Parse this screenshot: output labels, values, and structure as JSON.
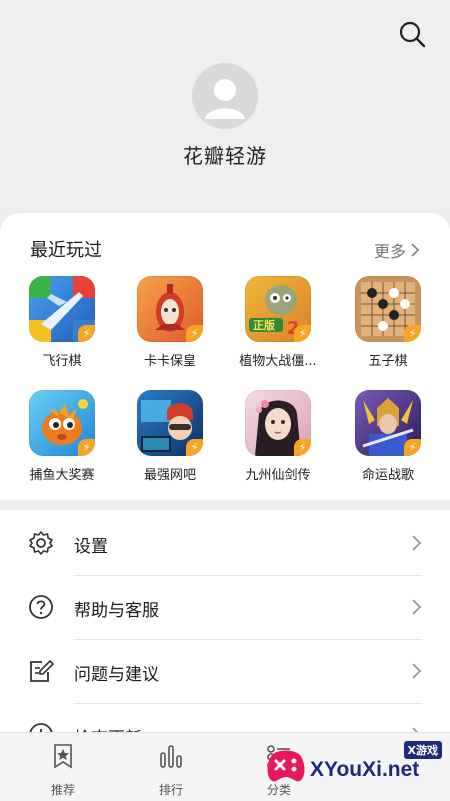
{
  "header": {
    "username": "花瓣轻游",
    "search_icon": "search-icon",
    "avatar_icon": "avatar-icon"
  },
  "recent": {
    "title": "最近玩过",
    "more_label": "更多",
    "games": [
      {
        "name": "飞行棋",
        "icon": "ludo-plane-icon",
        "color": "#3a7bd5"
      },
      {
        "name": "卡卡保皇",
        "icon": "robot-card-icon",
        "color": "#e8643a"
      },
      {
        "name": "植物大战僵...",
        "icon": "zombie-game-icon",
        "color": "#e59b2a"
      },
      {
        "name": "五子棋",
        "icon": "gomoku-board-icon",
        "color": "#c8955a"
      },
      {
        "name": "捕鱼大奖赛",
        "icon": "fish-game-icon",
        "color": "#2ea3e6"
      },
      {
        "name": "最强网吧",
        "icon": "internet-cafe-icon",
        "color": "#1e4e8c"
      },
      {
        "name": "九州仙剑传",
        "icon": "fantasy-girl-icon",
        "color": "#e9b8c4"
      },
      {
        "name": "命运战歌",
        "icon": "warrior-game-icon",
        "color": "#4a3a8a"
      }
    ]
  },
  "menu": [
    {
      "label": "设置",
      "icon": "gear-icon"
    },
    {
      "label": "帮助与客服",
      "icon": "help-icon"
    },
    {
      "label": "问题与建议",
      "icon": "feedback-icon"
    },
    {
      "label": "检查更新",
      "icon": "update-icon"
    }
  ],
  "bottom_nav": [
    {
      "label": "推荐",
      "icon": "recommend-icon"
    },
    {
      "label": "排行",
      "icon": "ranking-icon"
    },
    {
      "label": "分类",
      "icon": "category-icon"
    }
  ],
  "watermark": {
    "text": "XYouXi.net",
    "badge": "X游戏"
  }
}
